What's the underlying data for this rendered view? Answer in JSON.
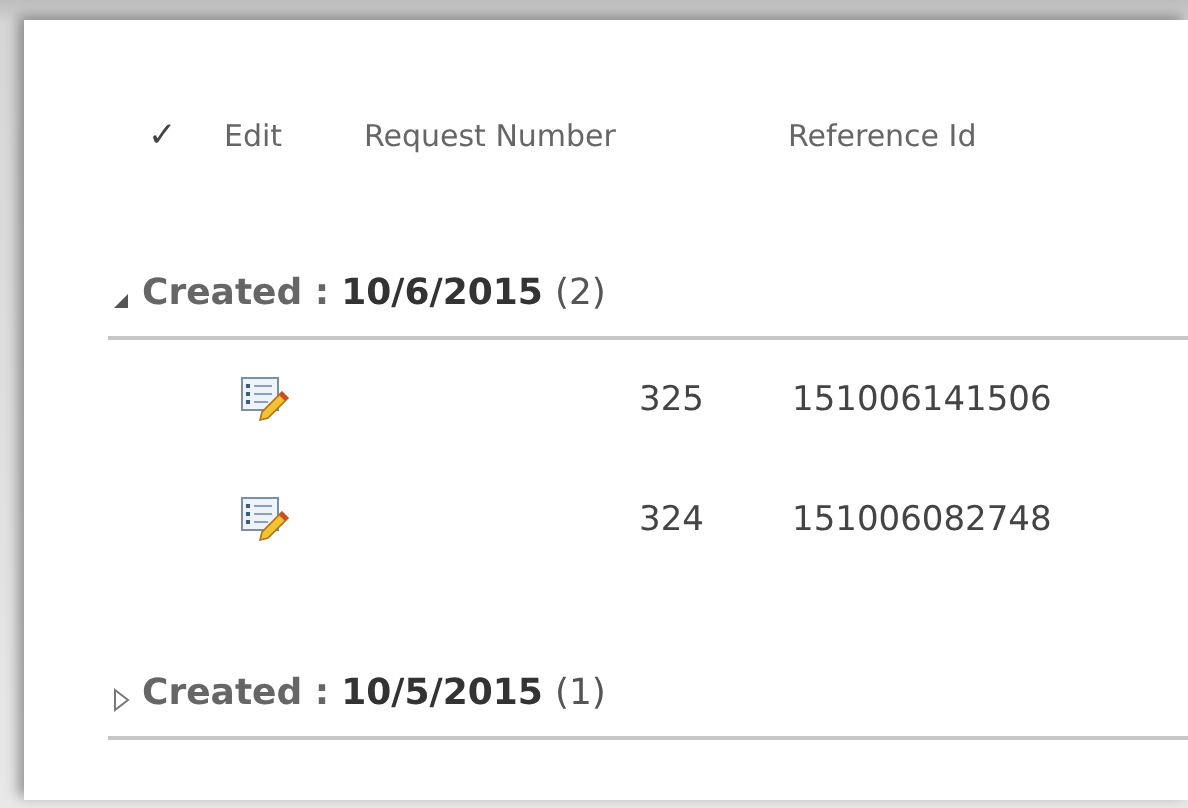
{
  "header": {
    "check": "✓",
    "columns": [
      "Edit",
      "Request Number",
      "Reference Id"
    ]
  },
  "groups": [
    {
      "field": "Created :",
      "value": "10/6/2015",
      "count": "(2)",
      "expanded": true,
      "rows": [
        {
          "request_number": "325",
          "reference_id": "151006141506"
        },
        {
          "request_number": "324",
          "reference_id": "151006082748"
        }
      ]
    },
    {
      "field": "Created :",
      "value": "10/5/2015",
      "count": "(1)",
      "expanded": false
    }
  ]
}
